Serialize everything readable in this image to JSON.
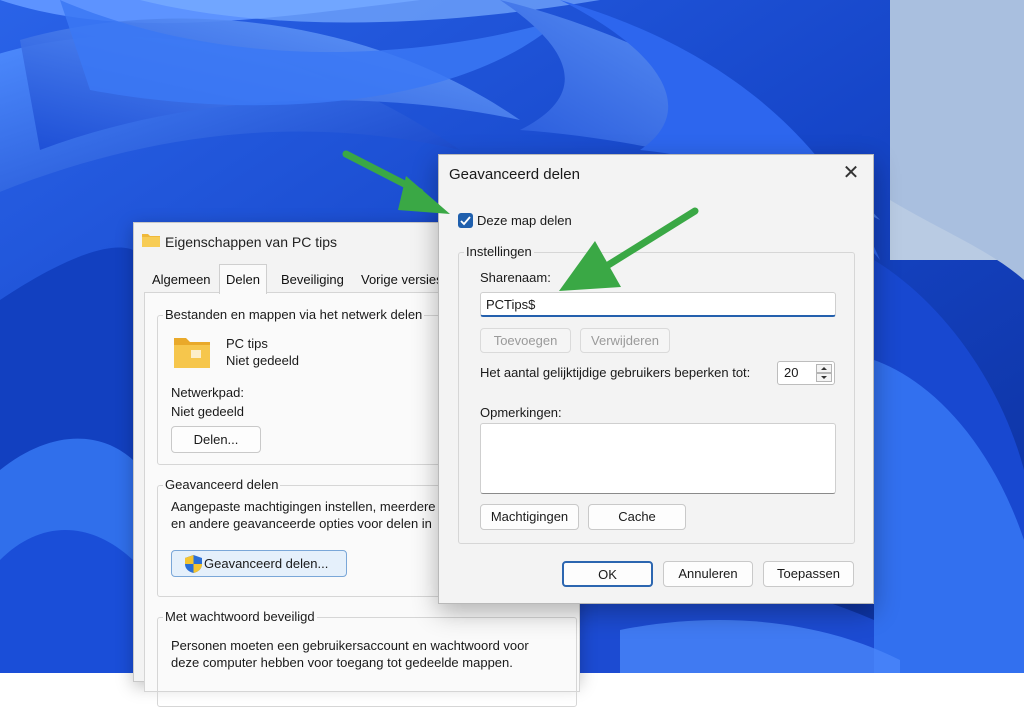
{
  "properties_window": {
    "title": "Eigenschappen van PC tips",
    "tabs": [
      "Algemeen",
      "Delen",
      "Beveiliging",
      "Vorige versies"
    ],
    "network_group": {
      "title": "Bestanden en mappen via het netwerk delen",
      "folder_name": "PC tips",
      "folder_status": "Niet gedeeld",
      "network_path_label": "Netwerkpad:",
      "network_path_value": "Niet gedeeld",
      "share_button": "Delen..."
    },
    "advanced_group": {
      "title": "Geavanceerd delen",
      "description_line1": "Aangepaste machtigingen instellen, meerdere",
      "description_line2": "en andere geavanceerde opties voor delen in",
      "button": "Geavanceerd delen..."
    },
    "password_group": {
      "title": "Met wachtwoord beveiligd",
      "description_line1": "Personen moeten een gebruikersaccount en wachtwoord voor",
      "description_line2": "deze computer hebben voor toegang tot gedeelde mappen."
    }
  },
  "advanced_dialog": {
    "title": "Geavanceerd delen",
    "share_checkbox_label": "Deze map delen",
    "share_checked": true,
    "settings_group_title": "Instellingen",
    "share_name_label": "Sharenaam:",
    "share_name_value": "PCTips$",
    "add_button": "Toevoegen",
    "remove_button": "Verwijderen",
    "limit_label": "Het aantal gelijktijdige gebruikers beperken tot:",
    "limit_value": "20",
    "comments_label": "Opmerkingen:",
    "comments_value": "",
    "permissions_button": "Machtigingen",
    "cache_button": "Cache",
    "ok_button": "OK",
    "cancel_button": "Annuleren",
    "apply_button": "Toepassen"
  },
  "colors": {
    "accent": "#1f5fad",
    "arrow": "#3aa845",
    "wallpaper_base": "#1a4fd6"
  },
  "icons": [
    "folder-icon",
    "shield-icon",
    "close-icon",
    "checkmark-icon",
    "spin-up-icon",
    "spin-down-icon",
    "arrow-pointer"
  ]
}
